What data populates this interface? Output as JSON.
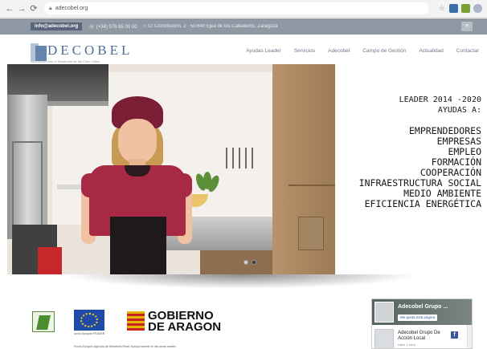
{
  "browser": {
    "url": "adecobel.org",
    "back_icon": "arrow-left",
    "forward_icon": "arrow-right",
    "reload_icon": "reload"
  },
  "top_bar": {
    "email": "info@adecobel.org",
    "phone": "(+34) 976 65 00 00",
    "address": "C/ Constitución, 2 · 50.640 Ejea de los Caballeros, Zaragoza"
  },
  "logo": {
    "name": "DECOBEL",
    "tagline": "Asociación para el Desarrollo de las Cinco Villas"
  },
  "nav": {
    "items": [
      "Ayudas Leader",
      "Servicios",
      "Adecobel",
      "Campo de Gestión",
      "Actualidad",
      "Contactar"
    ]
  },
  "hero": {
    "heading_line1": "LEADER 2014 -2020",
    "heading_line2": "AYUDAS A:",
    "items": [
      "EMPRENDEDORES",
      "EMPRESAS",
      "EMPLEO",
      "FORMACIÓN",
      "COOPERACIÓN",
      "INFRAESTRUCTURA SOCIAL",
      "MEDIO AMBIENTE",
      "EFICIENCIA ENERGÉTICA"
    ],
    "slide_count": 2,
    "active_slide": 1
  },
  "footer": {
    "eu_caption": "Unión Europea FEADER",
    "gov_line1": "GOBIERNO",
    "gov_line2": "DE ARAGON",
    "note": "Fondo Europeo Agrícola de Desarrollo Rural: Europa invierte en las zonas rurales"
  },
  "fb": {
    "cover_title": "Adecobel Grupo ...",
    "like_label": "Me gusta esta página",
    "page_name": "Adecobel Grupo De Acción Local",
    "sub": "Hace 1 hora"
  },
  "colors": {
    "top_bar": "#8f99a4",
    "brand": "#4d6d9a",
    "gov_red": "#c8221f",
    "gov_yellow": "#e2b500"
  }
}
